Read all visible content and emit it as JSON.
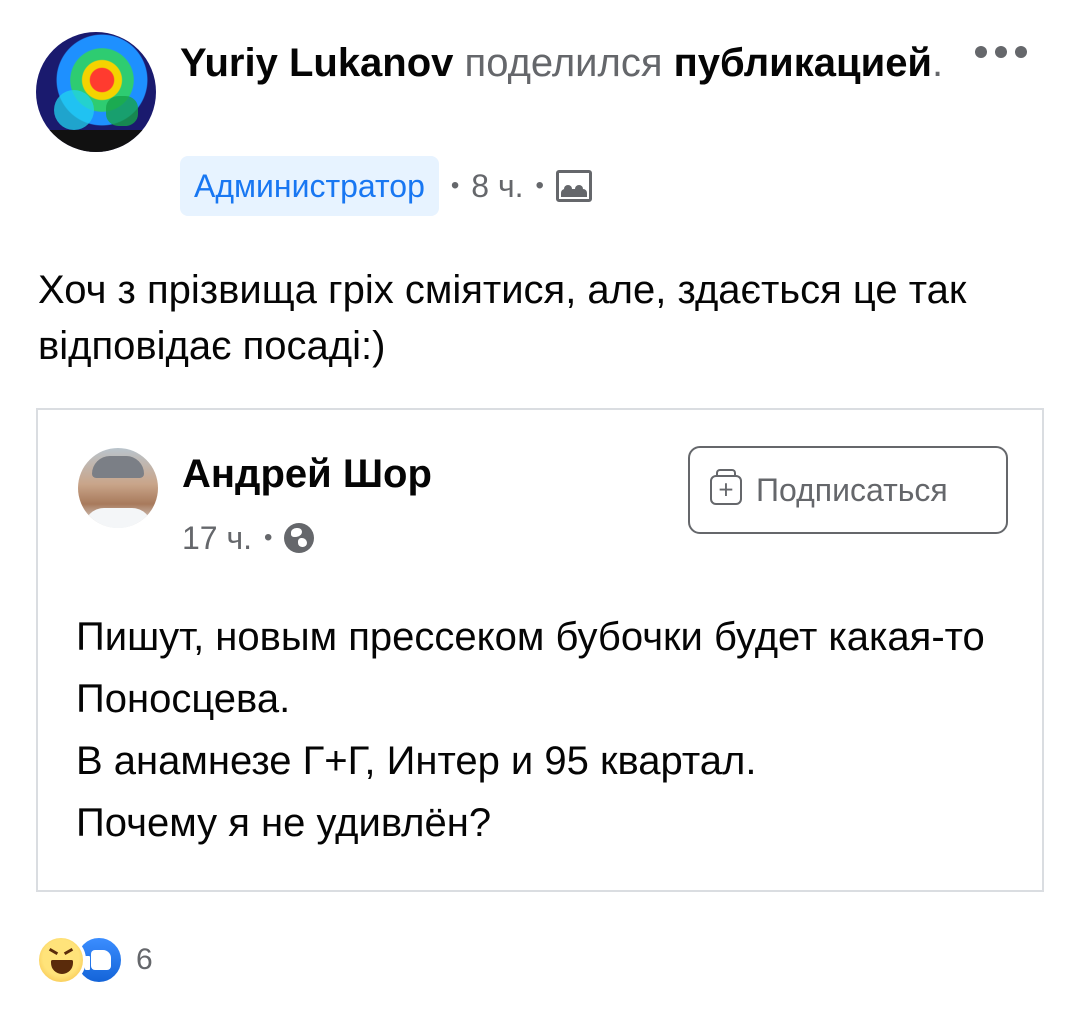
{
  "post": {
    "author": "Yuriy Lukanov",
    "action": " поделился ",
    "target": "публикацией",
    "dot": ".",
    "role_badge": "Администратор",
    "time": "8 ч.",
    "sep": "•",
    "text": "Хоч з прізвища гріх сміятися, але, здається це так відповідає посаді:)"
  },
  "shared": {
    "author": "Андрей Шор",
    "time": "17 ч.",
    "sep": "•",
    "subscribe_label": "Подписаться",
    "text": "Пишут, новым прессеком бубочки будет какая-то Поносцева.\nВ анамнезе Г+Г, Интер и 95 квартал.\nПочему я не удивлён?"
  },
  "reactions": {
    "count": "6",
    "types": [
      "haha",
      "like"
    ]
  },
  "icons": {
    "more": "more-horizontal-icon",
    "audience_post": "photo-album-icon",
    "audience_shared": "globe-icon",
    "subscribe": "add-follow-icon"
  },
  "colors": {
    "text_primary": "#050505",
    "text_secondary": "#65676b",
    "accent": "#1877f2",
    "badge_bg": "#e7f3ff"
  }
}
